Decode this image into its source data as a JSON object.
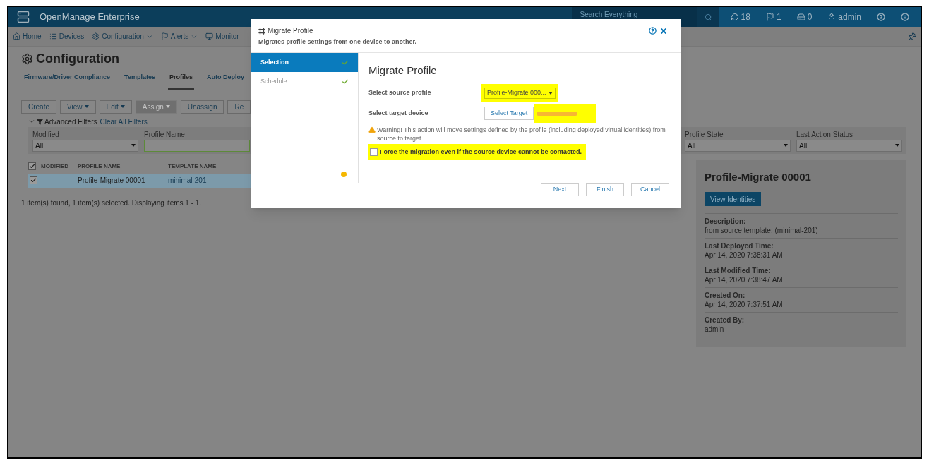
{
  "app": {
    "title": "OpenManage Enterprise",
    "search": {
      "placeholder": "Search Everything"
    },
    "counters": [
      {
        "kind": "jobs",
        "label": "18"
      },
      {
        "kind": "alerts",
        "label": "1"
      },
      {
        "kind": "devices",
        "label": "0"
      },
      {
        "kind": "user",
        "label": "admin"
      },
      {
        "kind": "help"
      },
      {
        "kind": "info"
      }
    ]
  },
  "nav": [
    {
      "kind": "home",
      "label": "Home",
      "has_menu": false
    },
    {
      "kind": "devices",
      "label": "Devices",
      "has_menu": false
    },
    {
      "kind": "configuration",
      "label": "Configuration",
      "has_menu": true
    },
    {
      "kind": "alerts",
      "label": "Alerts",
      "has_menu": true
    },
    {
      "kind": "monitor",
      "label": "Monitor",
      "has_menu": false
    }
  ],
  "page": {
    "title": "Configuration",
    "tabs": [
      {
        "label": "Firmware/Driver Compliance",
        "selected": false
      },
      {
        "label": "Templates",
        "selected": false
      },
      {
        "label": "Profiles",
        "selected": true
      },
      {
        "label": "Auto Deploy",
        "selected": false
      }
    ],
    "toolbar": [
      {
        "label": "Create",
        "has_menu": false,
        "disabled": false
      },
      {
        "label": "View",
        "has_menu": true,
        "disabled": false
      },
      {
        "label": "Edit",
        "has_menu": true,
        "disabled": false
      },
      {
        "label": "Assign",
        "has_menu": true,
        "disabled": true
      },
      {
        "label": "Unassign",
        "has_menu": false,
        "disabled": false
      },
      {
        "label": "Re",
        "has_menu": false,
        "disabled": false
      }
    ],
    "filters": {
      "label": "Advanced Filters",
      "clear_link": "Clear All Filters",
      "left": [
        {
          "kind": "select",
          "label": "Modified",
          "value": "All"
        },
        {
          "kind": "input",
          "label": "Profile Name"
        }
      ],
      "right": [
        {
          "kind": "select",
          "label": "Profile State",
          "value": "All"
        },
        {
          "kind": "select",
          "label": "Last Action Status",
          "value": "All"
        }
      ]
    },
    "table": {
      "all_checked": true,
      "columns": [
        "MODIFIED",
        "PROFILE NAME",
        "TEMPLATE NAME"
      ],
      "rows": [
        {
          "checked": true,
          "selected": true,
          "cells": [
            "",
            "Profile-Migrate 00001",
            "minimal-201"
          ]
        }
      ]
    },
    "status": "1 item(s) found, 1 item(s) selected. Displaying items 1 - 1.",
    "details": {
      "title": "Profile-Migrate 00001",
      "button": "View Identities",
      "fields": [
        {
          "label": "Description:",
          "value": "from source template: (minimal-201)"
        },
        {
          "label": "Last Deployed Time:",
          "value": "Apr 14, 2020 7:38:31 AM"
        },
        {
          "label": "Last Modified Time:",
          "value": "Apr 14, 2020 7:38:47 AM"
        },
        {
          "label": "Created On:",
          "value": "Apr 14, 2020 7:37:51 AM"
        },
        {
          "label": "Created By:",
          "value": "admin"
        }
      ]
    }
  },
  "dialog": {
    "title": "Migrate Profile",
    "subtitle": "Migrates profile settings from one device to another.",
    "steps": [
      {
        "label": "Selection",
        "selected": true,
        "done": true
      },
      {
        "label": "Schedule",
        "selected": false,
        "done": true
      }
    ],
    "heading": "Migrate Profile",
    "source": {
      "label": "Select source profile",
      "value": "Profile-Migrate 000...",
      "highlighted": true
    },
    "target": {
      "label": "Select target device",
      "button": "Select Target",
      "highlighted": true
    },
    "warning": "Warning! This action will move settings defined by the profile (including deployed virtual identities) from source to target.",
    "force": {
      "label": "Force the migration even if the source device cannot be contacted.",
      "checked": false,
      "highlighted": true
    },
    "buttons": [
      "Next",
      "Finish",
      "Cancel"
    ]
  }
}
